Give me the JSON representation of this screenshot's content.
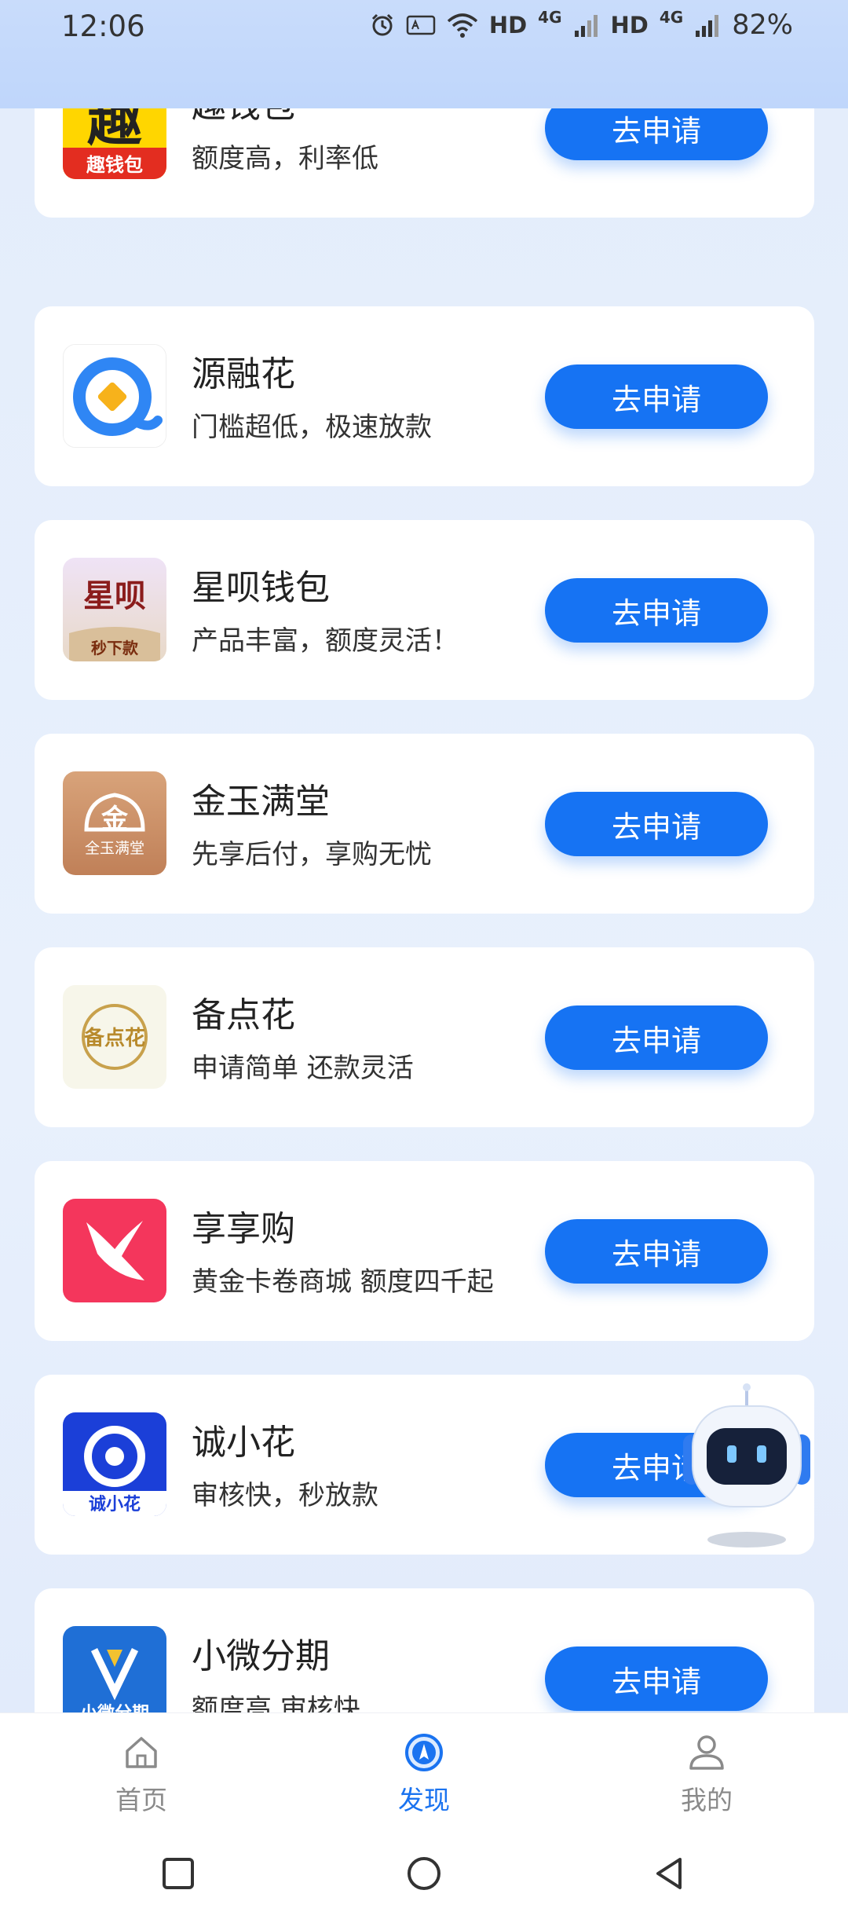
{
  "status_bar": {
    "time": "12:06",
    "hd1": "HD",
    "net1": "4G",
    "hd2": "HD",
    "net2": "4G",
    "battery": "82%"
  },
  "products": [
    {
      "name": "趣钱包",
      "desc": "额度高，利率低",
      "button": "去申请",
      "logo_text": "趣钱包"
    },
    {
      "name": "源融花",
      "desc": "门槛超低，极速放款",
      "button": "去申请"
    },
    {
      "name": "星呗钱包",
      "desc": "产品丰富，额度灵活！",
      "button": "去申请",
      "logo_text": "秒下款"
    },
    {
      "name": "金玉满堂",
      "desc": "先享后付，享购无忧",
      "button": "去申请",
      "logo_text": "全玉满堂"
    },
    {
      "name": "备点花",
      "desc": "申请简单 还款灵活",
      "button": "去申请",
      "logo_text": "备点花"
    },
    {
      "name": "享享购",
      "desc": "黄金卡卷商城 额度四千起",
      "button": "去申请"
    },
    {
      "name": "诚小花",
      "desc": "审核快，秒放款",
      "button": "去申请",
      "logo_text": "诚小花"
    },
    {
      "name": "小微分期",
      "desc": "额度高 审核快",
      "button": "去申请",
      "logo_text": "小微分期"
    }
  ],
  "tabbar": {
    "tabs": [
      {
        "label": "首页",
        "icon": "home-icon"
      },
      {
        "label": "发现",
        "icon": "compass-icon",
        "active": true
      },
      {
        "label": "我的",
        "icon": "user-icon"
      }
    ]
  },
  "colors": {
    "accent": "#1673f3",
    "active_tab": "#1a73f0",
    "background": "#e3ecfb"
  }
}
